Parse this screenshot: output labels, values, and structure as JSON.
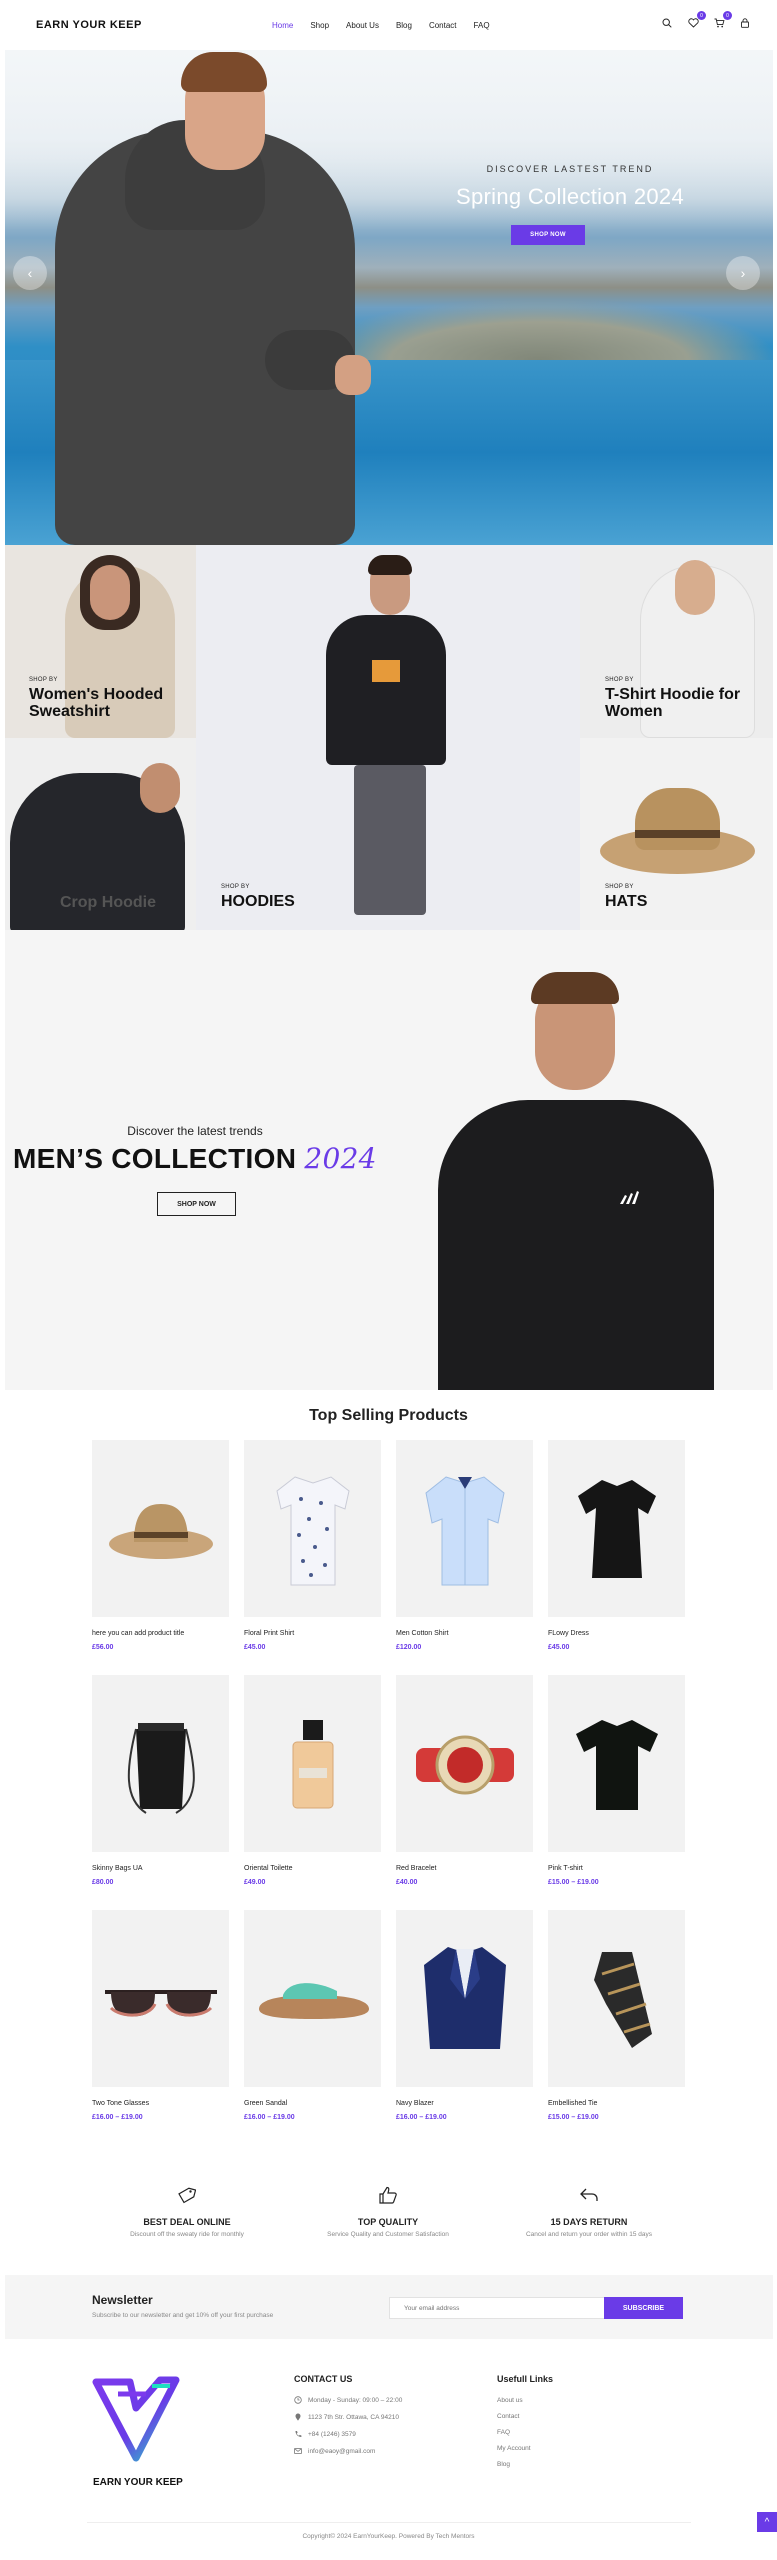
{
  "brand": {
    "logo_text": "EARN YOUR KEEP",
    "footer_logo_text": "EARN YOUR KEEP",
    "accent": "#6a3be7"
  },
  "nav": {
    "items": [
      {
        "label": "Home",
        "active": true
      },
      {
        "label": "Shop"
      },
      {
        "label": "About Us"
      },
      {
        "label": "Blog"
      },
      {
        "label": "Contact"
      },
      {
        "label": "FAQ"
      }
    ],
    "wishlist_count": "0",
    "cart_count": "0",
    "icons": [
      "search-icon",
      "heart-icon",
      "cart-icon",
      "account-icon"
    ]
  },
  "hero": {
    "subtitle": "DISCOVER LASTEST TREND",
    "title": "Spring Collection 2024",
    "button": "SHOP NOW",
    "prev": "‹",
    "next": "›"
  },
  "categories": {
    "womens": {
      "kicker": "SHOP BY",
      "title": "Women's Hooded Sweatshirt"
    },
    "tshirt": {
      "kicker": "SHOP BY",
      "title": "T-Shirt Hoodie for Women"
    },
    "crop": {
      "title": "Crop Hoodie"
    },
    "hoodies": {
      "kicker": "SHOP BY",
      "title": "HOODIES"
    },
    "hats": {
      "kicker": "SHOP BY",
      "title": "HATS"
    }
  },
  "mens": {
    "subtitle": "Discover the latest trends",
    "title": "MEN’S COLLECTION",
    "year": "2024",
    "button": "SHOP NOW"
  },
  "products": {
    "title": "Top Selling Products",
    "items": [
      {
        "name": "here you can add product title",
        "price": "£56.00",
        "icon": "hat"
      },
      {
        "name": "Floral Print Shirt",
        "price": "£45.00",
        "icon": "floral-shirt"
      },
      {
        "name": "Men Cotton Shirt",
        "price": "£120.00",
        "icon": "cotton-shirt"
      },
      {
        "name": "FLowy Dress",
        "price": "£45.00",
        "icon": "dress"
      },
      {
        "name": "Skinny Bags UA",
        "price": "£80.00",
        "icon": "drawstring-bag"
      },
      {
        "name": "Oriental Toilette",
        "price": "£49.00",
        "icon": "perfume"
      },
      {
        "name": "Red Bracelet",
        "price": "£40.00",
        "icon": "bracelet"
      },
      {
        "name": "Pink T-shirt",
        "price": "£15.00 – £19.00",
        "icon": "tshirt"
      },
      {
        "name": "Two Tone Glasses",
        "price": "£16.00 – £19.00",
        "icon": "glasses"
      },
      {
        "name": "Green Sandal",
        "price": "£16.00 – £19.00",
        "icon": "sandal"
      },
      {
        "name": "Navy Blazer",
        "price": "£16.00 – £19.00",
        "icon": "blazer"
      },
      {
        "name": "Embellished Tie",
        "price": "£15.00 – £19.00",
        "icon": "tie"
      }
    ]
  },
  "features": [
    {
      "icon": "tag-icon",
      "title": "BEST DEAL ONLINE",
      "desc": "Discount off the sweaty ride for monthly"
    },
    {
      "icon": "thumbs-up-icon",
      "title": "TOP QUALITY",
      "desc": "Service Quality and Customer Satisfaction"
    },
    {
      "icon": "return-arrow-icon",
      "title": "15 DAYS RETURN",
      "desc": "Cancel and return your order within 15 days"
    }
  ],
  "newsletter": {
    "title": "Newsletter",
    "desc": "Subscribe to our newsletter and get 10% off your first purchase",
    "placeholder": "Your email address",
    "button": "SUBSCRIBE"
  },
  "footer": {
    "contact_title": "CONTACT US",
    "contact": [
      {
        "icon": "clock-icon",
        "text": "Monday - Sunday: 09:00 – 22:00"
      },
      {
        "icon": "pin-icon",
        "text": "1123 7th Str. Ottawa, CA 94210"
      },
      {
        "icon": "phone-icon",
        "text": "+84 (1246) 3579"
      },
      {
        "icon": "mail-icon",
        "text": "info@eaoy@gmail.com"
      }
    ],
    "links_title": "Usefull Links",
    "links": [
      "About us",
      "Contact",
      "FAQ",
      "My Account",
      "Blog"
    ],
    "copyright": "Copyright© 2024 EarnYourKeep. Powered By Tech Mentors",
    "scroll_top": "^"
  }
}
